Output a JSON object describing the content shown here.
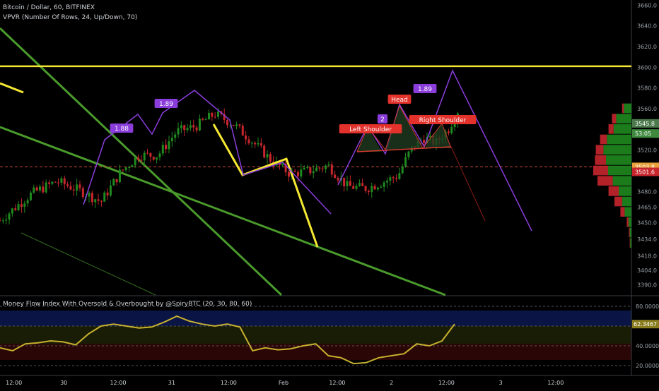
{
  "header": {
    "symbol_line": "Bitcoin / Dollar, 60, BITFINEX",
    "vpvr_line": "VPVR (Number Of Rows, 24, Up/Down, 70)",
    "mfi_line": "Money Flow Index With Oversold & Overbought by @SpiryBTC (20, 30, 80, 60)"
  },
  "colors": {
    "background": "#000000",
    "candle_up": "#1f8a1f",
    "candle_down": "#c8262d",
    "channel": "#4a9a2c",
    "yellow": "#f5e833",
    "purple": "#8a3ddb",
    "red_line": "#d63a2f",
    "mfi_line": "#c7b12e",
    "label_red": "#e3322c",
    "label_purple": "#8a3ddb"
  },
  "chart_data": [
    {
      "type": "line",
      "title": "Bitcoin / Dollar, 60, BITFINEX",
      "ylim": [
        3380,
        3665
      ],
      "y_ticks": [
        "3660.0",
        "3640.0",
        "3620.0",
        "3600.0",
        "3580.0",
        "3560.0",
        "3545.8",
        "3520.0",
        "3503.8",
        "3501.6",
        "3480.0",
        "3465.0",
        "3450.0",
        "3434.0",
        "3418.0",
        "3404.0",
        "3390.0"
      ],
      "x_ticks": [
        "12:00",
        "30",
        "12:00",
        "31",
        "12:00",
        "Feb",
        "12:00",
        "2",
        "12:00",
        "3",
        "12:00"
      ],
      "price_labels": [
        {
          "text": "3545.8",
          "value": 3545.8,
          "color": "#4c7a4c"
        },
        {
          "text": "53:05",
          "value": 3536,
          "color": "#3f8a3f"
        },
        {
          "text": "3503.8",
          "value": 3503.8,
          "color": "#e8a13a"
        },
        {
          "text": "3501.6",
          "value": 3499,
          "color": "#c8262d"
        }
      ],
      "annotations": [
        {
          "text": "1.88",
          "type": "fib"
        },
        {
          "text": "1.89",
          "type": "fib"
        },
        {
          "text": "2",
          "type": "fib"
        },
        {
          "text": "1.89",
          "type": "fib"
        },
        {
          "text": "Head",
          "type": "pattern"
        },
        {
          "text": "Left Shoulder",
          "type": "pattern"
        },
        {
          "text": "Right Shoulder",
          "type": "pattern"
        }
      ],
      "horizontal_line_level": 3601,
      "current_price_level": 3503.8,
      "price_path": [
        {
          "x": 0.0,
          "y": 3452
        },
        {
          "x": 0.05,
          "y": 3478
        },
        {
          "x": 0.09,
          "y": 3490
        },
        {
          "x": 0.13,
          "y": 3480
        },
        {
          "x": 0.16,
          "y": 3470
        },
        {
          "x": 0.19,
          "y": 3498
        },
        {
          "x": 0.22,
          "y": 3515
        },
        {
          "x": 0.25,
          "y": 3515
        },
        {
          "x": 0.28,
          "y": 3538
        },
        {
          "x": 0.31,
          "y": 3543
        },
        {
          "x": 0.34,
          "y": 3555
        },
        {
          "x": 0.37,
          "y": 3545
        },
        {
          "x": 0.4,
          "y": 3528
        },
        {
          "x": 0.43,
          "y": 3510
        },
        {
          "x": 0.46,
          "y": 3497
        },
        {
          "x": 0.49,
          "y": 3500
        },
        {
          "x": 0.52,
          "y": 3505
        },
        {
          "x": 0.55,
          "y": 3485
        },
        {
          "x": 0.58,
          "y": 3483
        },
        {
          "x": 0.61,
          "y": 3490
        },
        {
          "x": 0.63,
          "y": 3495
        },
        {
          "x": 0.65,
          "y": 3520
        },
        {
          "x": 0.67,
          "y": 3532
        },
        {
          "x": 0.69,
          "y": 3527
        },
        {
          "x": 0.71,
          "y": 3540
        },
        {
          "x": 0.725,
          "y": 3558
        }
      ],
      "volume_profile_rows": [
        {
          "price": 3560,
          "up": 0.18,
          "down": 0.04
        },
        {
          "price": 3550,
          "up": 0.36,
          "down": 0.1
        },
        {
          "price": 3540,
          "up": 0.42,
          "down": 0.12
        },
        {
          "price": 3530,
          "up": 0.58,
          "down": 0.16
        },
        {
          "price": 3520,
          "up": 0.66,
          "down": 0.18
        },
        {
          "price": 3510,
          "up": 0.6,
          "down": 0.26
        },
        {
          "price": 3500,
          "up": 0.55,
          "down": 0.35
        },
        {
          "price": 3490,
          "up": 0.44,
          "down": 0.36
        },
        {
          "price": 3480,
          "up": 0.3,
          "down": 0.24
        },
        {
          "price": 3470,
          "up": 0.22,
          "down": 0.18
        },
        {
          "price": 3460,
          "up": 0.16,
          "down": 0.1
        },
        {
          "price": 3450,
          "up": 0.07,
          "down": 0.04
        },
        {
          "price": 3440,
          "up": 0.04,
          "down": 0.02
        },
        {
          "price": 3430,
          "up": 0.03,
          "down": 0.01
        }
      ]
    },
    {
      "type": "line",
      "title": "Money Flow Index With Oversold & Overbought by @SpiryBTC (20, 30, 80, 60)",
      "ylim": [
        10,
        90
      ],
      "y_ticks": [
        "80.0000",
        "62.3467",
        "40.0000",
        "20.0000"
      ],
      "levels": [
        80,
        60,
        40,
        20
      ],
      "last_value_label": "62.3467",
      "x": [
        0.0,
        0.02,
        0.04,
        0.06,
        0.08,
        0.1,
        0.12,
        0.14,
        0.16,
        0.18,
        0.2,
        0.22,
        0.24,
        0.26,
        0.28,
        0.3,
        0.32,
        0.34,
        0.36,
        0.38,
        0.4,
        0.42,
        0.44,
        0.46,
        0.48,
        0.5,
        0.52,
        0.54,
        0.56,
        0.58,
        0.6,
        0.62,
        0.64,
        0.66,
        0.68,
        0.7,
        0.72
      ],
      "values": [
        38,
        35,
        42,
        43,
        45,
        44,
        41,
        52,
        60,
        62,
        60,
        58,
        59,
        64,
        70,
        65,
        62,
        60,
        62,
        59,
        35,
        38,
        36,
        37,
        40,
        42,
        30,
        28,
        22,
        23,
        28,
        30,
        32,
        42,
        40,
        45,
        62
      ]
    }
  ]
}
